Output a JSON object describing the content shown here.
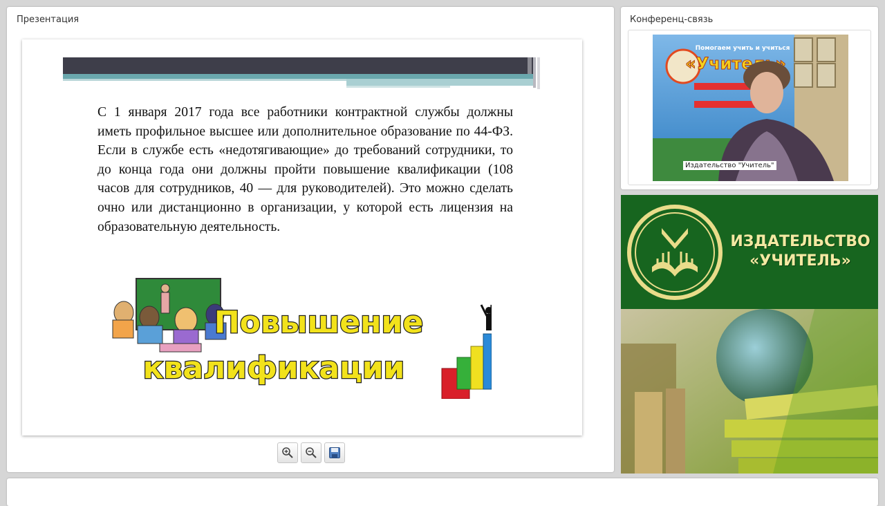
{
  "presentation": {
    "panel_title": "Презентация",
    "slide": {
      "body_text": "С 1 января 2017 года все работники контрактной службы должны иметь профильное высшее или дополнительное образование по 44-ФЗ. Если в службе есть «недотягивающие» до требований сотрудники, то до конца года они должны пройти повышение квалификации (108 часов для сотрудников, 40 — для руководителей). Это можно сделать очно или дистанционно в организации, у которой есть лицензия на образовательную деятельность.",
      "banner_line1": "Повышение",
      "banner_line2": "квалификации"
    },
    "toolbar": {
      "zoom_in_icon": "zoom-in-icon",
      "zoom_out_icon": "zoom-out-icon",
      "save_icon": "save-icon"
    }
  },
  "conference": {
    "panel_title": "Конференц-связь",
    "video_label": "Издательство \"Учитель\"",
    "poster_line1": "Помогаем учить и учиться",
    "poster_line2": "«Учитель»"
  },
  "publisher_banner": {
    "name_line1": "ИЗДАТЕЛЬСТВО",
    "name_line2": "«УЧИТЕЛЬ»"
  },
  "colors": {
    "banner_green": "#17651f",
    "logo_gold": "#e9dc8a",
    "slide_bar_dark": "#3e3e4a",
    "slide_bar_teal": "#6aa7ad",
    "art_text_yellow": "#f2e21b"
  }
}
